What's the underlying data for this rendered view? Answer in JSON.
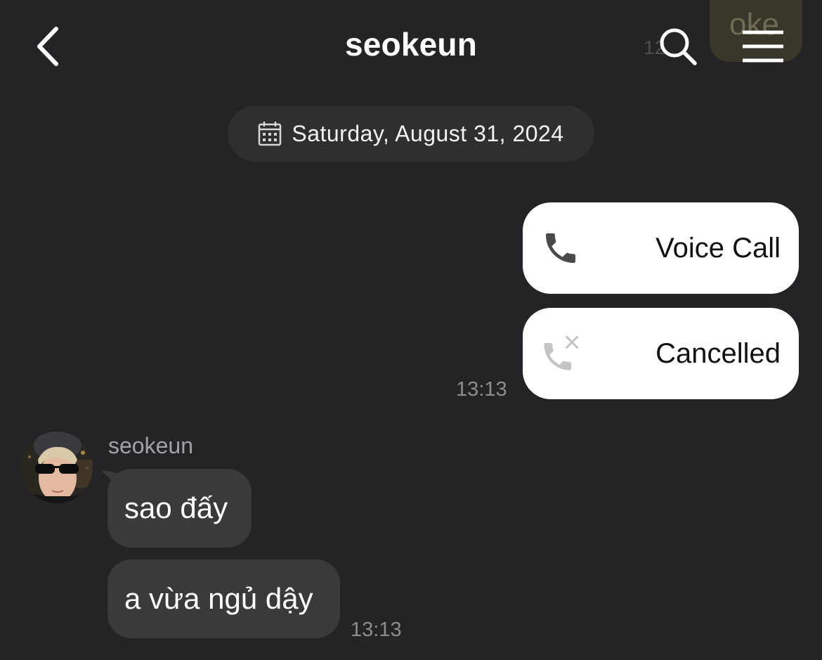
{
  "header": {
    "title": "seokeun",
    "back_icon": "chevron-left-icon",
    "search_icon": "search-icon",
    "menu_icon": "hamburger-menu-icon"
  },
  "background_peek": {
    "message_text": "oke",
    "time": "12"
  },
  "date_separator": {
    "icon": "calendar-icon",
    "label": "Saturday, August 31, 2024"
  },
  "outgoing": {
    "calls": [
      {
        "label": "Voice Call",
        "icon": "phone-icon"
      },
      {
        "label": "Cancelled",
        "icon": "phone-cancelled-icon"
      }
    ],
    "time": "13:13"
  },
  "incoming": {
    "sender": "seokeun",
    "messages": [
      {
        "text": "sao đấy"
      },
      {
        "text": "a vừa ngủ dậy"
      }
    ],
    "time": "13:13"
  },
  "colors": {
    "background": "#242426",
    "incoming_bubble": "#3a3a3c",
    "outgoing_call_bubble": "#ffffff",
    "timestamp": "#8d8d90"
  }
}
